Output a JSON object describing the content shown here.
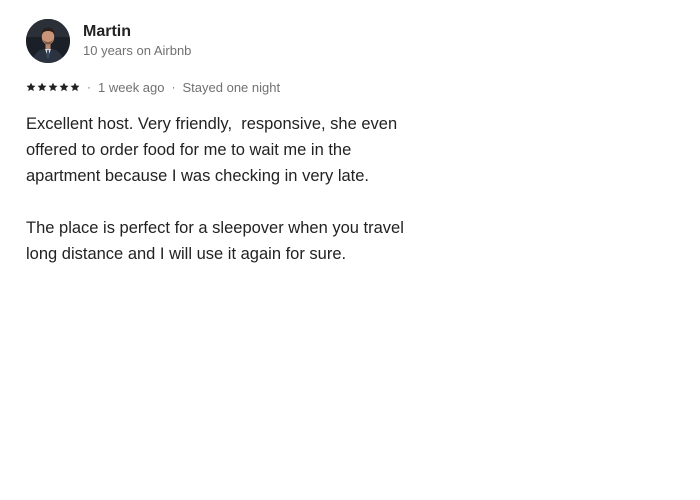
{
  "reviewer": {
    "name": "Martin",
    "tenure": "10 years on Airbnb",
    "avatar_icon": "user-avatar-photo"
  },
  "rating": {
    "stars": 5,
    "max_stars": 5,
    "star_color": "#222222"
  },
  "meta": {
    "date": "1 week ago",
    "separator": "·",
    "stay": "Stayed one night"
  },
  "review": {
    "paragraphs": [
      "Excellent host. Very friendly,  responsive, she even offered to order food for me to wait me in the apartment because I was checking in very late.",
      "The place is perfect for a sleepover when you travel long distance and I will use it again for sure."
    ]
  },
  "colors": {
    "text_primary": "#222222",
    "text_secondary": "#717171",
    "background": "#ffffff"
  }
}
